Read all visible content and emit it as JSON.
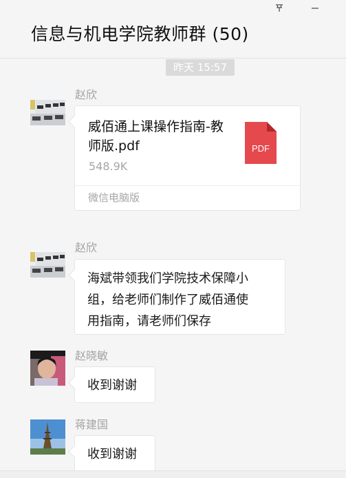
{
  "window": {
    "title": "信息与机电学院教师群 (50)",
    "pin_icon": "pin-icon",
    "minimize_icon": "minimize-icon"
  },
  "timestamp": "昨天 15:57",
  "messages": [
    {
      "sender": "赵欣",
      "file": {
        "name": "威佰通上课操作指南-教师版.pdf",
        "size": "548.9K",
        "icon_label": "PDF",
        "source": "微信电脑版"
      }
    },
    {
      "sender": "赵欣",
      "text_lines": [
        "海斌带领我们学院技术保障小",
        "组，给老师们制作了威佰通使",
        "用指南，请老师们保存"
      ]
    },
    {
      "sender": "赵晓敏",
      "text": "收到谢谢"
    },
    {
      "sender": "蒋建国",
      "text": "收到谢谢"
    }
  ],
  "colors": {
    "pdf_red": "#e5484d",
    "background": "#f5f5f5"
  }
}
